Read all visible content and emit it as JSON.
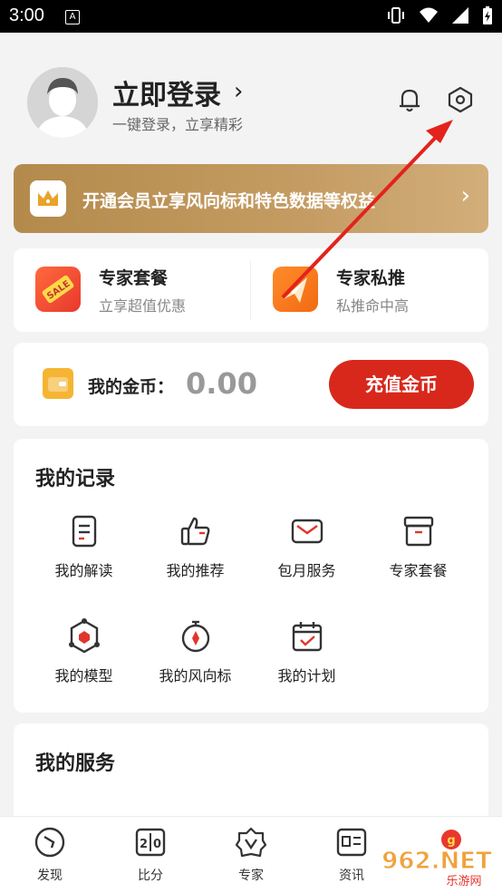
{
  "status_bar": {
    "time": "3:00",
    "sim_glyph": "A"
  },
  "header": {
    "login_title": "立即登录",
    "login_arrow": "›",
    "login_subtitle": "一键登录，立享精彩"
  },
  "vip_banner": {
    "text": "开通会员立享风向标和特色数据等权益",
    "chevron": "›"
  },
  "expert": {
    "items": [
      {
        "title": "专家套餐",
        "subtitle": "立享超值优惠",
        "badge": "SALE"
      },
      {
        "title": "专家私推",
        "subtitle": "私推命中高"
      }
    ]
  },
  "coins": {
    "label": "我的金币：",
    "value": "0.00",
    "button": "充值金币"
  },
  "records": {
    "title": "我的记录",
    "items": [
      {
        "label": "我的解读",
        "icon": "document-icon"
      },
      {
        "label": "我的推荐",
        "icon": "thumbs-up-icon"
      },
      {
        "label": "包月服务",
        "icon": "mail-icon"
      },
      {
        "label": "专家套餐",
        "icon": "package-box-icon"
      },
      {
        "label": "我的模型",
        "icon": "hexagon-model-icon"
      },
      {
        "label": "我的风向标",
        "icon": "stopwatch-compass-icon"
      },
      {
        "label": "我的计划",
        "icon": "calendar-check-icon"
      }
    ]
  },
  "services": {
    "title": "我的服务"
  },
  "bottom_nav": {
    "items": [
      {
        "label": "发现",
        "icon": "compass-icon"
      },
      {
        "label": "比分",
        "icon": "scoreboard-icon",
        "glyph": "2|0"
      },
      {
        "label": "专家",
        "icon": "expert-badge-icon"
      },
      {
        "label": "资讯",
        "icon": "news-icon"
      }
    ]
  },
  "watermark": {
    "text": "962.NET",
    "subtext": "乐游网"
  },
  "colors": {
    "accent_red": "#d8281b",
    "vip_gold": "#c49b62",
    "coin_orange": "#f5b533"
  }
}
